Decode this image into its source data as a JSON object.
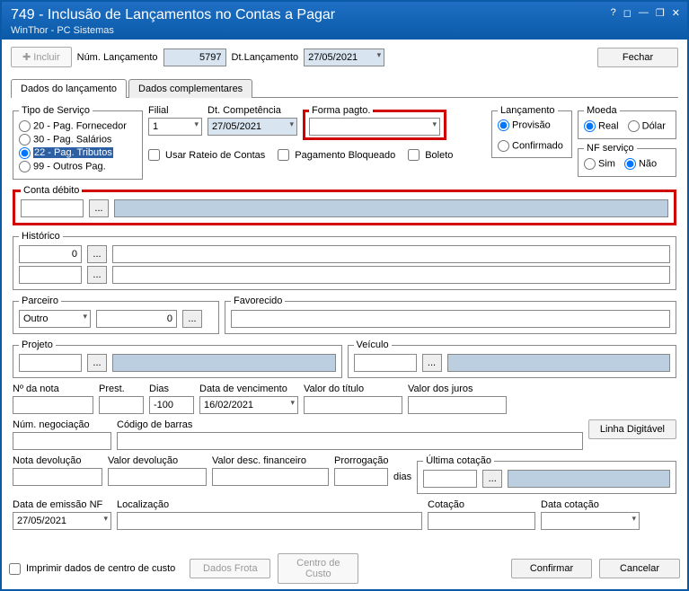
{
  "window": {
    "title": "749 - Inclusão de Lançamentos no Contas a Pagar",
    "subtitle": "WinThor - PC Sistemas",
    "help": "?",
    "tool": "◻",
    "min": "—",
    "restore": "❐",
    "close": "✕"
  },
  "toolbar": {
    "incluir": "Incluir",
    "num_lanc_lbl": "Núm. Lançamento",
    "num_lanc_val": "5797",
    "dt_lanc_lbl": "Dt.Lançamento",
    "dt_lanc_val": "27/05/2021",
    "fechar": "Fechar"
  },
  "tabs": {
    "t1": "Dados do lançamento",
    "t2": "Dados complementares"
  },
  "tipo_servico": {
    "legend": "Tipo de Serviço",
    "o1": "20 - Pag. Fornecedor",
    "o2": "30 - Pag. Salários",
    "o3": "22 - Pag. Tributos",
    "o4": "99 - Outros Pag."
  },
  "filial": {
    "lbl": "Filial",
    "val": "1"
  },
  "dt_comp": {
    "lbl": "Dt. Competência",
    "val": "27/05/2021"
  },
  "forma_pagto": {
    "lbl": "Forma pagto.",
    "val": ""
  },
  "checks": {
    "rateio": "Usar Rateio de Contas",
    "bloq": "Pagamento Bloqueado",
    "boleto": "Boleto"
  },
  "lancamento": {
    "legend": "Lançamento",
    "o1": "Provisão",
    "o2": "Confirmado"
  },
  "moeda": {
    "legend": "Moeda",
    "o1": "Real",
    "o2": "Dólar"
  },
  "nf": {
    "legend": "NF serviço",
    "o1": "Sim",
    "o2": "Não"
  },
  "conta_debito": {
    "legend": "Conta débito"
  },
  "historico": {
    "legend": "Histórico",
    "v1": "0"
  },
  "parceiro": {
    "legend": "Parceiro",
    "sel": "Outro",
    "val": "0"
  },
  "favorecido": {
    "legend": "Favorecido"
  },
  "projeto": {
    "legend": "Projeto"
  },
  "veiculo": {
    "legend": "Veículo"
  },
  "nota": {
    "lbl": "Nº da nota"
  },
  "prest": {
    "lbl": "Prest."
  },
  "dias": {
    "lbl": "Dias",
    "val": "-100"
  },
  "venc": {
    "lbl": "Data de vencimento",
    "val": "16/02/2021"
  },
  "vtitulo": {
    "lbl": "Valor do título"
  },
  "vjuros": {
    "lbl": "Valor dos juros"
  },
  "neg": {
    "lbl": "Núm. negociação"
  },
  "barras": {
    "lbl": "Código de barras"
  },
  "linha_dig": "Linha Digitável",
  "ndev": {
    "lbl": "Nota devolução"
  },
  "vdev": {
    "lbl": "Valor devolução"
  },
  "vdesc": {
    "lbl": "Valor desc. financeiro"
  },
  "prorr": {
    "lbl": "Prorrogação",
    "dias": "dias"
  },
  "ult_cot": {
    "legend": "Última cotação"
  },
  "emissao": {
    "lbl": "Data de emissão NF",
    "val": "27/05/2021"
  },
  "local": {
    "lbl": "Localização"
  },
  "cotacao": {
    "lbl": "Cotação"
  },
  "data_cot": {
    "lbl": "Data cotação"
  },
  "footer": {
    "imprimir": "Imprimir dados de centro de custo",
    "frota": "Dados Frota",
    "centro": "Centro de Custo",
    "confirmar": "Confirmar",
    "cancelar": "Cancelar"
  },
  "ellipsis": "..."
}
